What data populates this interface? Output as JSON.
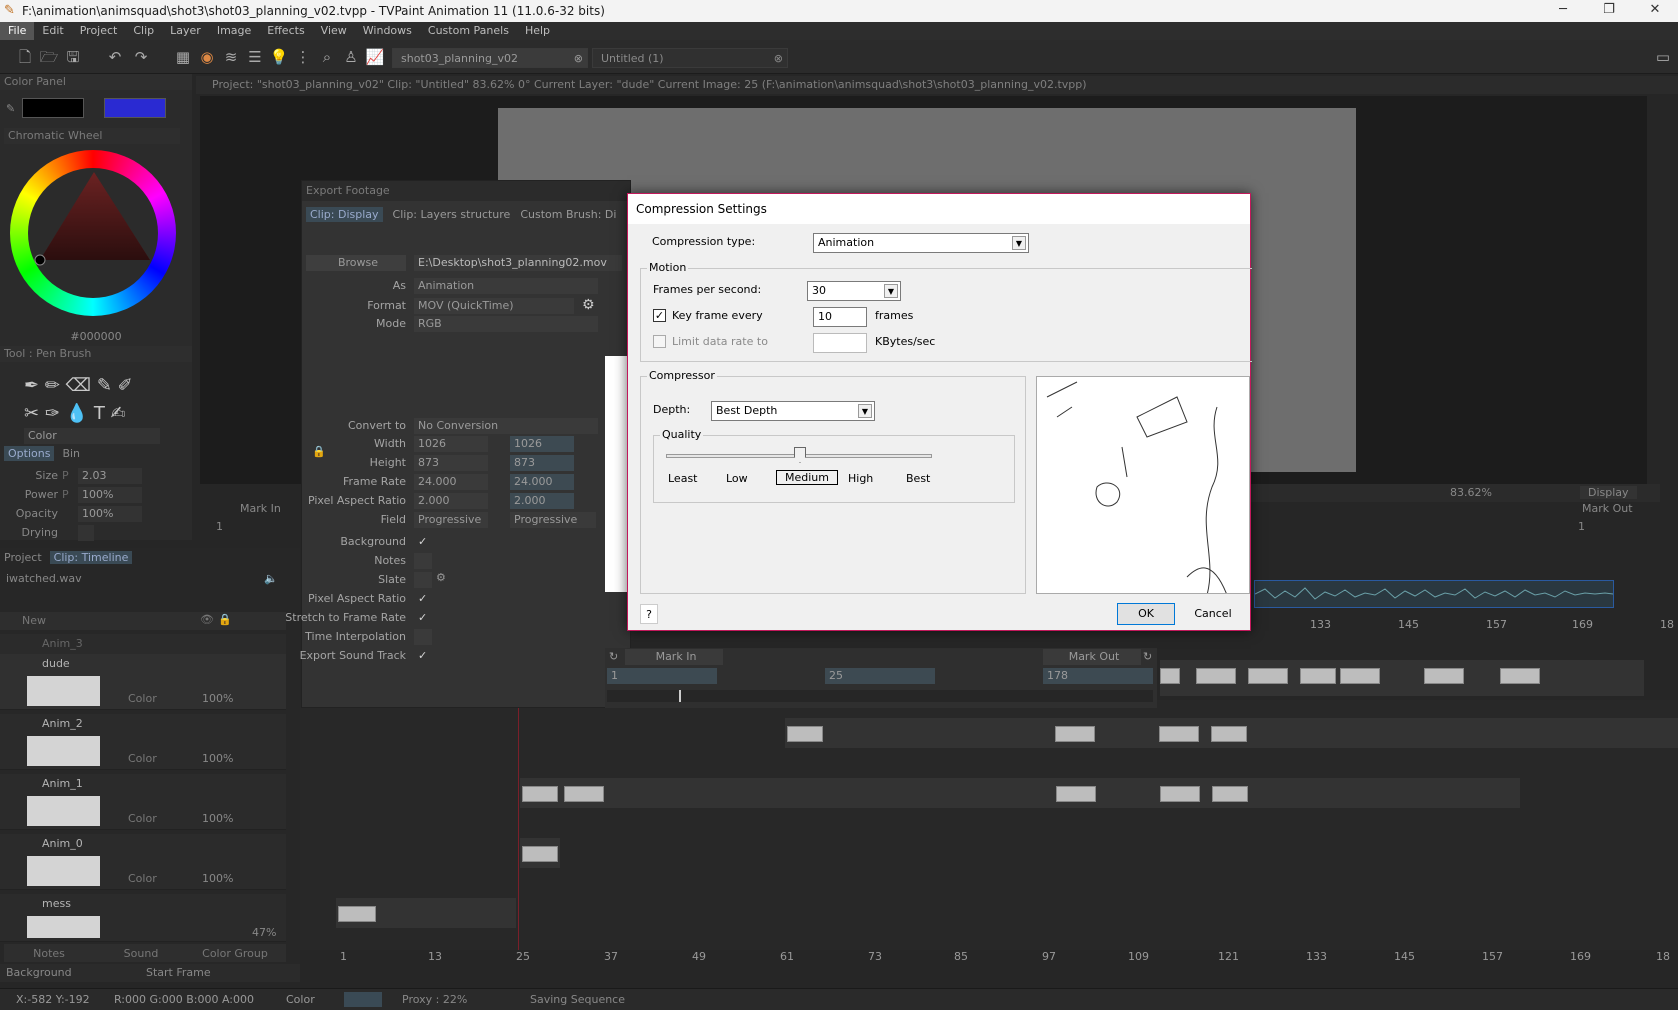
{
  "window": {
    "title": "F:\\animation\\animsquad\\shot3\\shot03_planning_v02.tvpp - TVPaint Animation 11 (11.0.6-32 bits)",
    "minimize_icon": "minimize-icon",
    "maximize_icon": "maximize-icon",
    "close_icon": "close-icon"
  },
  "menu": [
    "File",
    "Edit",
    "Project",
    "Clip",
    "Layer",
    "Image",
    "Effects",
    "View",
    "Windows",
    "Custom Panels",
    "Help"
  ],
  "toolbar": {
    "tabs": [
      "shot03_planning_v02",
      "Untitled (1)"
    ]
  },
  "project_info": "Project: \"shot03_planning_v02\"  Clip: \"Untitled\"  83.62%  0°  Current Layer: \"dude\"  Current Image: 25 (F:\\animation\\animsquad\\shot3\\shot03_planning_v02.tvpp)",
  "color_panel": {
    "title": "Color Panel",
    "wheel_title": "Chromatic Wheel",
    "hex": "#000000",
    "primary": "#000000",
    "secondary": "#2a2ad2"
  },
  "tool_panel": {
    "title": "Tool : Pen Brush",
    "color_label": "Color",
    "tabs": [
      "Options",
      "Bin"
    ],
    "rows": [
      {
        "label": "Size",
        "mode": "P",
        "value": "2.03"
      },
      {
        "label": "Power",
        "mode": "P",
        "value": "100%"
      },
      {
        "label": "Opacity",
        "mode": "",
        "value": "100%"
      },
      {
        "label": "Drying",
        "mode": "",
        "value": ""
      }
    ]
  },
  "export": {
    "title": "Export Footage",
    "tabs": [
      "Clip: Display",
      "Clip: Layers structure",
      "Custom Brush: Di"
    ],
    "browse_label": "Browse",
    "path": "E:\\Desktop\\shot3_planning02.mov",
    "as_label": "As",
    "as_value": "Animation",
    "format_label": "Format",
    "format_value": "MOV (QuickTime)",
    "mode_label": "Mode",
    "mode_value": "RGB",
    "convert_label": "Convert to",
    "convert_value": "No Conversion",
    "width_label": "Width",
    "width_a": "1026",
    "width_b": "1026",
    "height_label": "Height",
    "height_a": "873",
    "height_b": "873",
    "framerate_label": "Frame Rate",
    "framerate_a": "24.000",
    "framerate_b": "24.000",
    "par_label": "Pixel Aspect Ratio",
    "par_a": "2.000",
    "par_b": "2.000",
    "field_label": "Field",
    "field_a": "Progressive",
    "field_b": "Progressive",
    "checks": [
      {
        "label": "Background",
        "checked": "✓"
      },
      {
        "label": "Notes",
        "checked": ""
      },
      {
        "label": "Slate",
        "checked": ""
      },
      {
        "label": "Pixel Aspect Ratio",
        "checked": "✓"
      },
      {
        "label": "Stretch to Frame Rate",
        "checked": "✓"
      },
      {
        "label": "Time Interpolation",
        "checked": ""
      },
      {
        "label": "Export Sound Track",
        "checked": "✓"
      }
    ],
    "mark_in_label": "Mark In",
    "mark_out_label": "Mark Out",
    "mark_in": "1",
    "current": "25",
    "mark_out": "178"
  },
  "compression": {
    "title": "Compression Settings",
    "type_label": "Compression type:",
    "type_value": "Animation",
    "motion_label": "Motion",
    "fps_label": "Frames per second:",
    "fps_value": "30",
    "keyframe_label": "Key frame every",
    "keyframe_value": "10",
    "keyframe_unit": "frames",
    "limit_label": "Limit data rate to",
    "limit_unit": "KBytes/sec",
    "compressor_label": "Compressor",
    "depth_label": "Depth:",
    "depth_value": "Best Depth",
    "quality_label": "Quality",
    "quality_level": 0.5,
    "quality_ticks": [
      "Least",
      "Low",
      "Medium",
      "High",
      "Best"
    ],
    "help": "?",
    "ok": "OK",
    "cancel": "Cancel"
  },
  "viewer": {
    "zoom": "83.62%",
    "display": "Display",
    "mark_in": "Mark In",
    "mark_out": "Mark Out",
    "mark_in_value": "1",
    "mark_out_value": "1"
  },
  "project_panel": {
    "tabs": [
      "Project",
      "Clip: Timeline"
    ],
    "sound_file": "iwatched.wav",
    "new_label": "New",
    "layers": [
      {
        "name": "Anim_3",
        "color": "Color",
        "opacity": "100%"
      },
      {
        "name": "dude",
        "color": "Color",
        "opacity": "100%"
      },
      {
        "name": "Anim_2",
        "color": "Color",
        "opacity": "100%"
      },
      {
        "name": "Anim_1",
        "color": "Color",
        "opacity": "100%"
      },
      {
        "name": "Anim_0",
        "color": "Color",
        "opacity": "100%"
      },
      {
        "name": "mess",
        "color": "Color",
        "opacity": "47%"
      }
    ],
    "bottom_tabs": [
      "Notes",
      "Sound",
      "Color Group"
    ],
    "background": "Background",
    "start_frame": "Start Frame"
  },
  "ruler": [
    "1",
    "13",
    "25",
    "37",
    "49",
    "61",
    "73",
    "85",
    "97",
    "109",
    "121",
    "133",
    "145",
    "157",
    "169",
    "18"
  ],
  "top_ruler": [
    "133",
    "145",
    "157",
    "169",
    "18"
  ],
  "status": {
    "coords": "X:-582  Y:-192",
    "rgba": "R:000 G:000 B:000 A:000",
    "color": "Color",
    "proxy": "Proxy : 22%",
    "saving": "Saving Sequence"
  }
}
